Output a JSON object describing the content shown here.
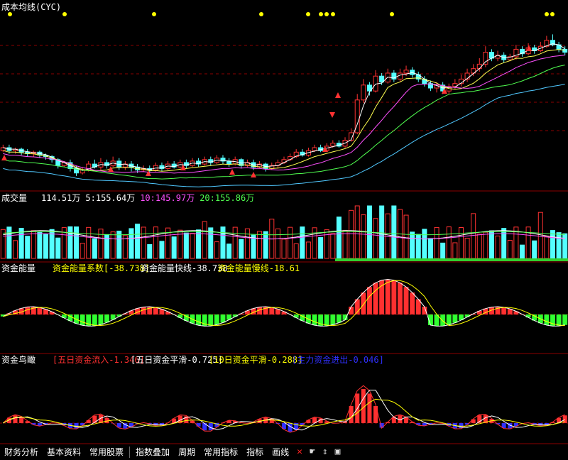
{
  "colors": {
    "up": "#ff3232",
    "down": "#54ffff",
    "ma1": "#ffffff",
    "ma2": "#ffff50",
    "ma3": "#ff50ff",
    "ma4": "#50ff50",
    "ma5": "#50c8ff",
    "grid": "#8b0000",
    "white": "#ffffff",
    "yellow": "#ffff00",
    "magenta": "#ff50ff",
    "blue": "#3030ff",
    "red": "#ff3030",
    "green": "#30ff30"
  },
  "panels": {
    "main": {
      "title": "成本均线(CYC)"
    },
    "volume": {
      "title": "成交量",
      "items": [
        {
          "text": "114.51万",
          "color": "#ffffff"
        },
        {
          "text": "5:155.64万",
          "color": "#ffffff"
        },
        {
          "text": "10:145.97万",
          "color": "#ff50ff"
        },
        {
          "text": "20:155.86万",
          "color": "#50ff50"
        }
      ]
    },
    "energy": {
      "title": "资金能量",
      "items": [
        {
          "text": "资金能量系数[-38.738]",
          "color": "#ffff00"
        },
        {
          "text": "资金能量快线-38.738",
          "color": "#ffffff"
        },
        {
          "text": "资金能量慢线-18.61",
          "color": "#ffff00"
        }
      ]
    },
    "bird": {
      "title": "资金鸟瞰",
      "items": [
        {
          "text": "[五日资金流入-1.346]",
          "color": "#ff3030"
        },
        {
          "text": "[五日资金平滑-0.725]",
          "color": "#ffffff"
        },
        {
          "text": "[10日资金平滑-0.288]",
          "color": "#ffff00"
        },
        {
          "text": "[主力资金进出-0.046]",
          "color": "#3030ff"
        }
      ]
    }
  },
  "toolbar": {
    "buttons": [
      "财务分析",
      "基本资料",
      "常用股票",
      "指数叠加",
      "周期",
      "常用指标",
      "指标",
      "画线"
    ]
  },
  "chart_data": [
    {
      "type": "candlestick",
      "title": "成本均线(CYC)",
      "x_range": [
        0,
        100
      ],
      "y_range": [
        0,
        100
      ],
      "candles": [
        [
          0,
          18,
          20,
          17,
          22,
          15
        ],
        [
          1,
          20,
          18,
          16,
          22,
          15
        ],
        [
          2,
          18,
          19,
          16,
          20,
          15
        ],
        [
          3,
          19,
          17,
          15,
          20,
          14
        ],
        [
          4,
          17,
          16,
          14,
          19,
          13
        ],
        [
          5,
          16,
          17,
          14,
          18,
          13
        ],
        [
          6,
          17,
          15,
          13,
          18,
          12
        ],
        [
          7,
          15,
          14,
          12,
          16,
          11
        ],
        [
          8,
          14,
          12,
          10,
          15,
          9
        ],
        [
          9,
          12,
          8,
          6,
          13,
          5
        ],
        [
          10,
          8,
          10,
          7,
          11,
          6
        ],
        [
          11,
          10,
          6,
          4,
          12,
          3
        ],
        [
          12,
          6,
          3,
          1,
          8,
          0
        ],
        [
          13,
          3,
          5,
          2,
          7,
          1
        ],
        [
          14,
          5,
          9,
          4,
          11,
          3
        ],
        [
          15,
          9,
          7,
          6,
          12,
          5
        ],
        [
          16,
          7,
          10,
          5,
          13,
          4
        ],
        [
          17,
          10,
          8,
          6,
          12,
          5
        ],
        [
          18,
          8,
          11,
          7,
          14,
          6
        ],
        [
          19,
          11,
          7,
          5,
          13,
          4
        ],
        [
          20,
          7,
          9,
          5,
          11,
          4
        ],
        [
          21,
          9,
          7,
          4,
          11,
          3
        ],
        [
          22,
          7,
          5,
          3,
          9,
          2
        ],
        [
          23,
          5,
          6,
          4,
          8,
          3
        ],
        [
          24,
          6,
          5,
          3,
          8,
          2
        ],
        [
          25,
          5,
          8,
          4,
          10,
          3
        ],
        [
          26,
          8,
          6,
          4,
          10,
          3
        ],
        [
          27,
          6,
          9,
          5,
          11,
          4
        ],
        [
          28,
          9,
          7,
          6,
          11,
          5
        ],
        [
          29,
          7,
          10,
          6,
          12,
          5
        ],
        [
          30,
          10,
          8,
          6,
          12,
          5
        ],
        [
          31,
          8,
          11,
          7,
          13,
          6
        ],
        [
          32,
          11,
          9,
          7,
          13,
          6
        ],
        [
          33,
          9,
          12,
          8,
          14,
          7
        ],
        [
          34,
          12,
          10,
          8,
          14,
          7
        ],
        [
          35,
          10,
          13,
          9,
          15,
          8
        ],
        [
          36,
          13,
          11,
          9,
          15,
          8
        ],
        [
          37,
          11,
          9,
          7,
          13,
          6
        ],
        [
          38,
          9,
          12,
          8,
          14,
          7
        ],
        [
          39,
          12,
          8,
          6,
          13,
          5
        ],
        [
          40,
          8,
          10,
          7,
          12,
          6
        ],
        [
          41,
          10,
          7,
          5,
          12,
          4
        ],
        [
          42,
          7,
          9,
          6,
          11,
          5
        ],
        [
          43,
          9,
          6,
          4,
          10,
          3
        ],
        [
          44,
          6,
          8,
          5,
          10,
          4
        ],
        [
          45,
          8,
          10,
          6,
          12,
          5
        ],
        [
          46,
          10,
          12,
          9,
          14,
          8
        ],
        [
          47,
          12,
          14,
          11,
          16,
          10
        ],
        [
          48,
          14,
          17,
          13,
          19,
          12
        ],
        [
          49,
          17,
          15,
          14,
          19,
          13
        ],
        [
          50,
          15,
          18,
          14,
          20,
          13
        ],
        [
          51,
          18,
          20,
          17,
          22,
          16
        ],
        [
          52,
          20,
          18,
          17,
          22,
          16
        ],
        [
          53,
          18,
          21,
          17,
          23,
          16
        ],
        [
          54,
          21,
          23,
          20,
          25,
          19
        ],
        [
          55,
          23,
          21,
          20,
          25,
          19
        ],
        [
          56,
          21,
          25,
          20,
          27,
          19
        ],
        [
          57,
          25,
          30,
          24,
          33,
          23
        ],
        [
          58,
          30,
          52,
          29,
          56,
          28
        ],
        [
          59,
          52,
          62,
          50,
          66,
          49
        ],
        [
          60,
          62,
          58,
          55,
          64,
          53
        ],
        [
          61,
          58,
          68,
          57,
          72,
          56
        ],
        [
          62,
          68,
          64,
          62,
          70,
          61
        ],
        [
          63,
          64,
          70,
          63,
          73,
          62
        ],
        [
          64,
          70,
          66,
          64,
          72,
          63
        ],
        [
          65,
          66,
          70,
          64,
          73,
          63
        ],
        [
          66,
          70,
          72,
          68,
          75,
          67
        ],
        [
          67,
          72,
          69,
          67,
          74,
          66
        ],
        [
          68,
          69,
          66,
          64,
          71,
          63
        ],
        [
          69,
          66,
          63,
          61,
          68,
          60
        ],
        [
          70,
          63,
          60,
          58,
          65,
          57
        ],
        [
          71,
          60,
          62,
          57,
          64,
          56
        ],
        [
          72,
          62,
          58,
          56,
          64,
          55
        ],
        [
          73,
          58,
          61,
          56,
          63,
          55
        ],
        [
          74,
          61,
          63,
          59,
          66,
          58
        ],
        [
          75,
          63,
          66,
          61,
          69,
          60
        ],
        [
          76,
          66,
          70,
          64,
          73,
          63
        ],
        [
          77,
          70,
          73,
          68,
          76,
          67
        ],
        [
          78,
          73,
          76,
          71,
          80,
          70
        ],
        [
          79,
          76,
          84,
          74,
          88,
          73
        ],
        [
          80,
          84,
          80,
          78,
          86,
          77
        ],
        [
          81,
          80,
          82,
          78,
          85,
          77
        ],
        [
          82,
          82,
          79,
          77,
          84,
          76
        ],
        [
          83,
          79,
          81,
          78,
          83,
          77
        ],
        [
          84,
          81,
          86,
          79,
          89,
          78
        ],
        [
          85,
          86,
          83,
          81,
          88,
          80
        ],
        [
          86,
          83,
          87,
          82,
          90,
          81
        ],
        [
          87,
          87,
          85,
          83,
          89,
          82
        ],
        [
          88,
          85,
          88,
          84,
          91,
          83
        ],
        [
          89,
          88,
          92,
          87,
          95,
          86
        ],
        [
          90,
          92,
          89,
          88,
          96,
          87
        ],
        [
          91,
          89,
          86,
          84,
          91,
          83
        ],
        [
          92,
          86,
          84,
          82,
          88,
          81
        ]
      ],
      "annotations": "yellow diamonds along top and red triangles near selected candles"
    },
    {
      "type": "bar",
      "title": "成交量",
      "categories_count": 100,
      "series": [
        {
          "name": "5",
          "values": [
            155.64
          ]
        },
        {
          "name": "10",
          "values": [
            145.97
          ]
        },
        {
          "name": "20",
          "values": [
            155.86
          ]
        }
      ],
      "values": [
        114.51
      ]
    },
    {
      "type": "bar",
      "title": "资金能量",
      "series": [
        {
          "name": "资金能量系数",
          "values": [
            -38.738
          ]
        },
        {
          "name": "资金能量快线",
          "values": [
            -38.738
          ]
        },
        {
          "name": "资金能量慢线",
          "values": [
            -18.61
          ]
        }
      ]
    },
    {
      "type": "line",
      "title": "资金鸟瞰",
      "series": [
        {
          "name": "五日资金流入",
          "values": [
            -1.346
          ]
        },
        {
          "name": "五日资金平滑",
          "values": [
            -0.725
          ]
        },
        {
          "name": "10日资金平滑",
          "values": [
            -0.288
          ]
        },
        {
          "name": "主力资金进出",
          "values": [
            -0.046
          ]
        }
      ]
    }
  ]
}
